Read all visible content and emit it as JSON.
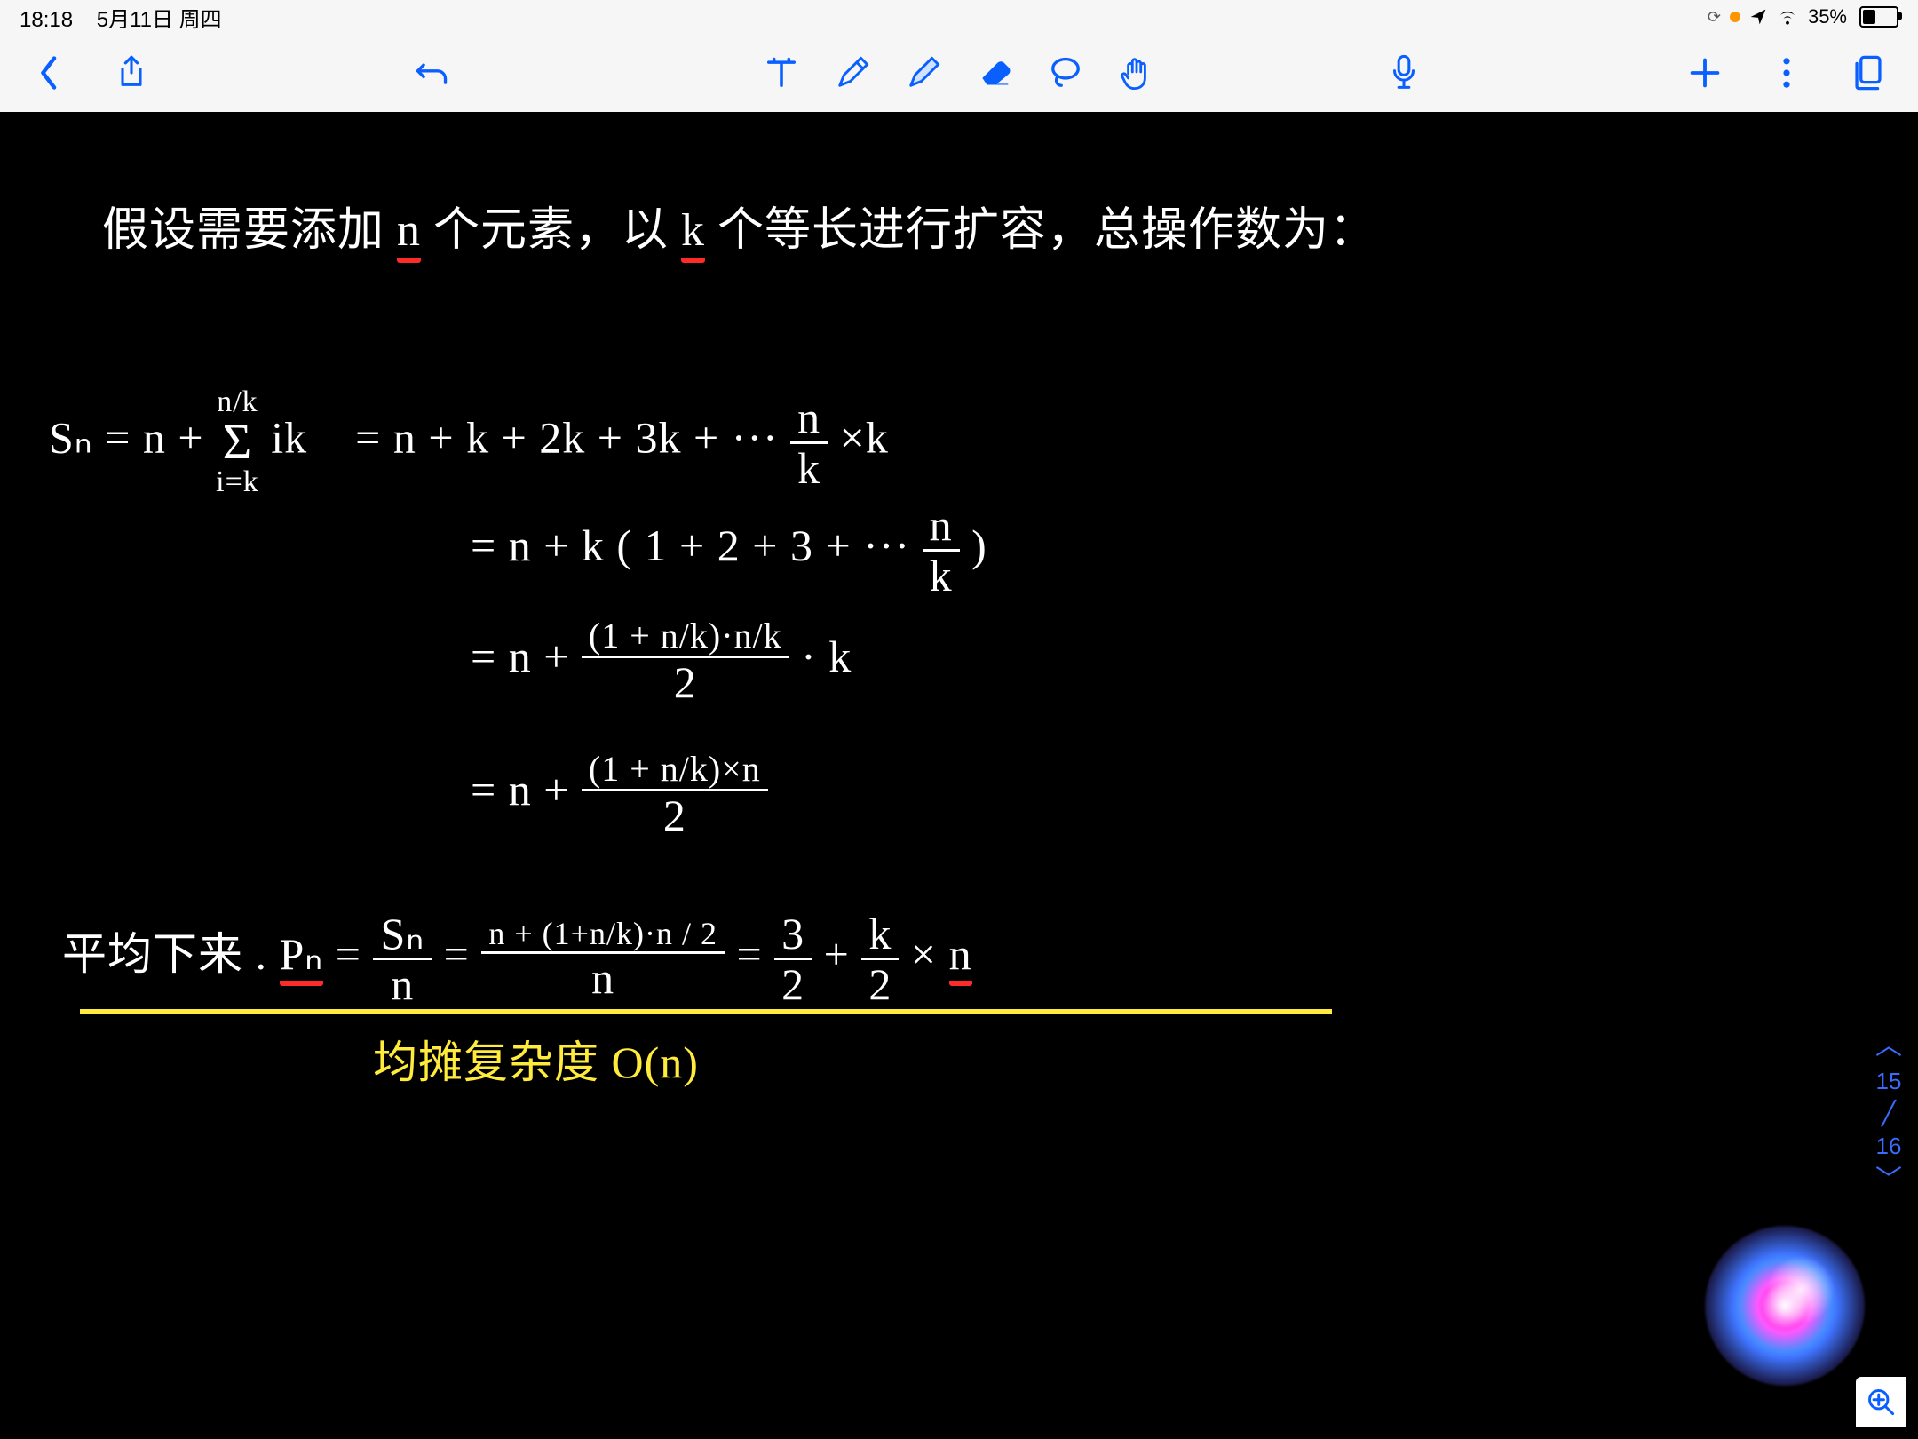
{
  "status": {
    "time": "18:18",
    "date": "5月11日 周四",
    "battery_pct": "35%"
  },
  "page": {
    "current": "15",
    "total": "16"
  },
  "notes": {
    "line1_a": "假设需要添加 ",
    "line1_n": "n",
    "line1_b": " 个元素，以 ",
    "line1_k": "k",
    "line1_c": " 个等长进行扩容，总操作数为：",
    "eq1_lhs": "Sₙ = n + ",
    "eq1_sum_top": "n/k",
    "eq1_sum_sym": "Σ",
    "eq1_sum_bot": "i=k",
    "eq1_sum_term": " ik",
    "eq1_rhs": " =  n + k + 2k + 3k + ··· ",
    "eq1_frac_nk": "n",
    "eq1_frac_nk_den": "k",
    "eq1_tail": "×k",
    "eq2": "= n + k ( 1 + 2 + 3 + ··· ",
    "eq2_tail": " )",
    "eq3_pre": "= n + ",
    "eq3_num": "(1 + n/k)·n/k",
    "eq3_den": "2",
    "eq3_tail": " · k",
    "eq4_pre": "= n + ",
    "eq4_num": "(1 + n/k)×n",
    "eq4_den": "2",
    "avg_a": "平均下来 . ",
    "avg_pn": "Pₙ",
    "avg_eq": " = ",
    "avg_sn": "Sₙ",
    "avg_n": "n",
    "avg_mid_num": "n + (1+n/k)·n / 2",
    "avg_mid_den": "n",
    "avg_r1n": "3",
    "avg_r1d": "2",
    "avg_plus": " + ",
    "avg_r2n": "k",
    "avg_r2d": "2",
    "avg_times": " × ",
    "avg_last": "n",
    "yellow_line": "均摊复杂度 O(n)"
  }
}
